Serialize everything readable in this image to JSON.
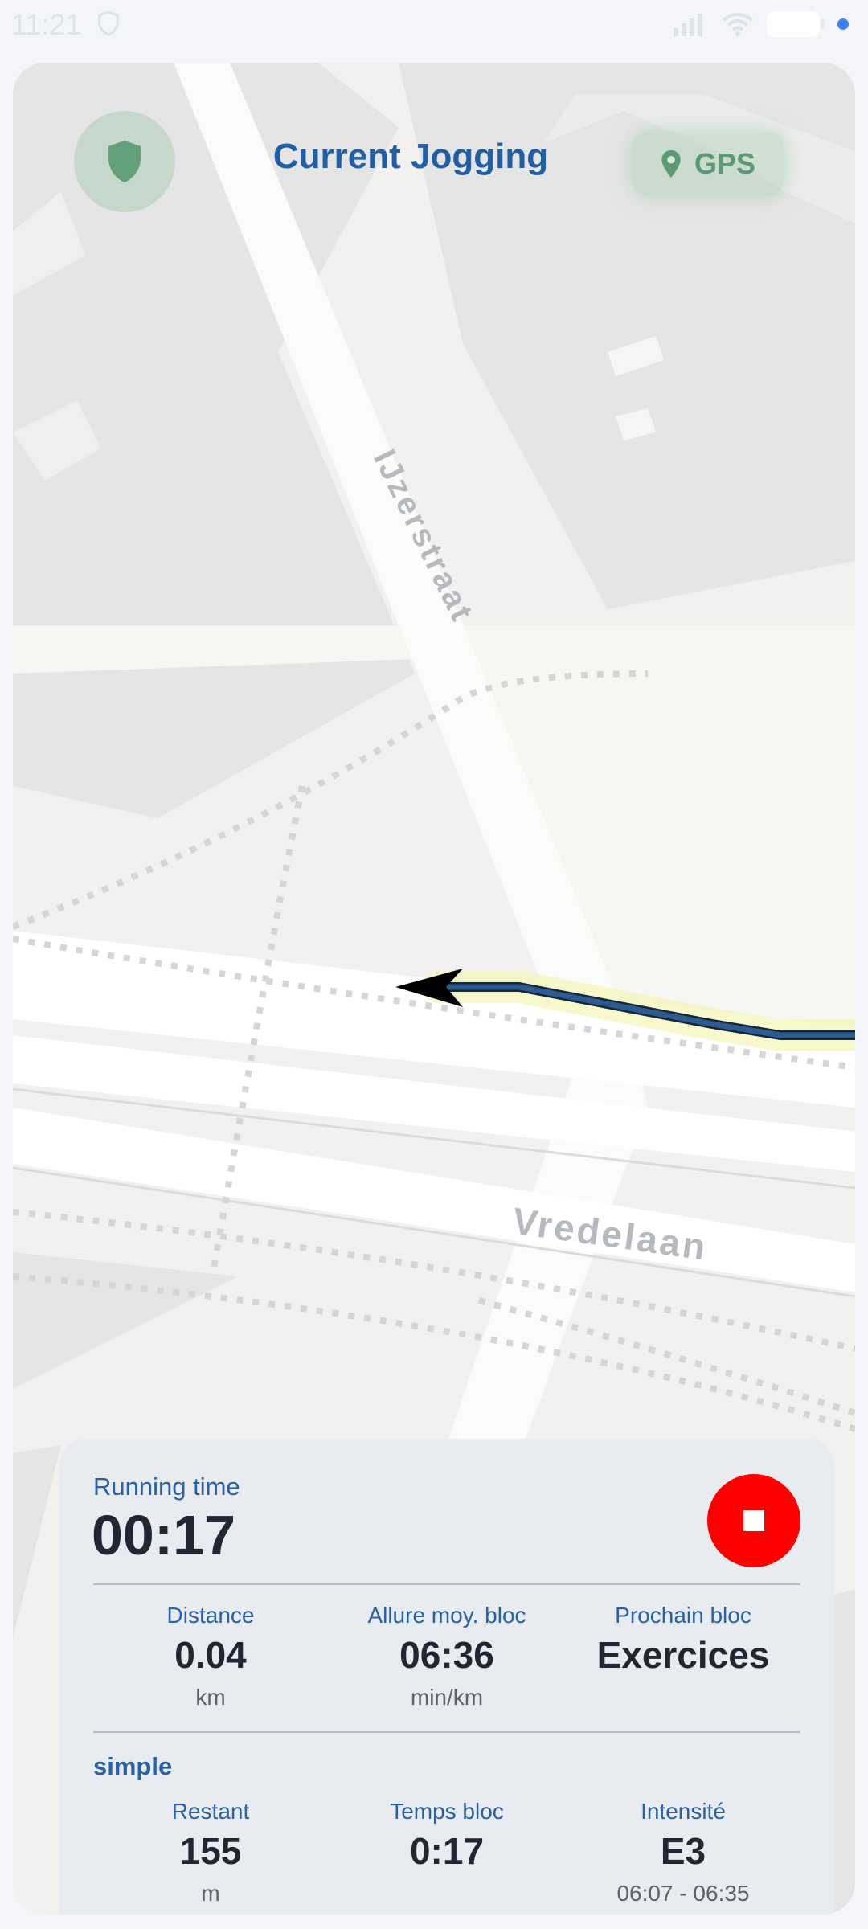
{
  "status_bar": {
    "time": "11:21",
    "shield_icon": "shield-outline-icon",
    "right_icons": [
      "signal-icon",
      "wifi-icon",
      "battery-icon",
      "notification-dot"
    ]
  },
  "header": {
    "title": "Current Jogging",
    "gps_label": "GPS",
    "shield_button_icon": "shield-icon",
    "gps_icon": "location-pin-icon"
  },
  "map": {
    "street_1": "IJzerstraat",
    "street_2": "Vredelaan",
    "route_color": "#2d5b8f",
    "direction_arrow_icon": "arrow-left-icon"
  },
  "stats": {
    "running_label": "Running time",
    "running_value": "00:17",
    "stop_icon": "stop-icon",
    "stop_color": "#ff0000",
    "row1": [
      {
        "label": "Distance",
        "value": "0.04",
        "unit": "km"
      },
      {
        "label": "Allure moy. bloc",
        "value": "06:36",
        "unit": "min/km"
      },
      {
        "label": "Prochain bloc",
        "value": "Exercices",
        "unit": ""
      }
    ],
    "section": "simple",
    "row2": [
      {
        "label": "Restant",
        "value": "155",
        "unit": "m"
      },
      {
        "label": "Temps bloc",
        "value": "0:17",
        "unit": ""
      },
      {
        "label": "Intensité",
        "value": "E3",
        "unit": "06:07 - 06:35"
      }
    ]
  },
  "colors": {
    "accent": "#1f5fa6",
    "label_blue": "#2a61a3",
    "gps_green": "#5b9a72",
    "panel_bg": "#e8ebf0"
  }
}
